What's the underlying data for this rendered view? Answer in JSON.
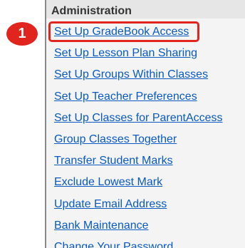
{
  "panel": {
    "title": "Administration",
    "links": [
      "Set Up GradeBook Access",
      "Set Up Lesson Plan Sharing",
      "Set Up Groups Within Classes",
      "Set Up Teacher Preferences",
      "Set Up Classes for ParentAccess",
      "Group Classes Together",
      "Transfer Student Marks",
      "Exclude Lowest Mark",
      "Update Email Address",
      "Bank Maintenance",
      "Change Your Password"
    ]
  },
  "callout": {
    "number": "1"
  },
  "colors": {
    "link": "#0a5ac2",
    "highlight": "#e2241f",
    "panel_background": "#f4f4f4"
  }
}
